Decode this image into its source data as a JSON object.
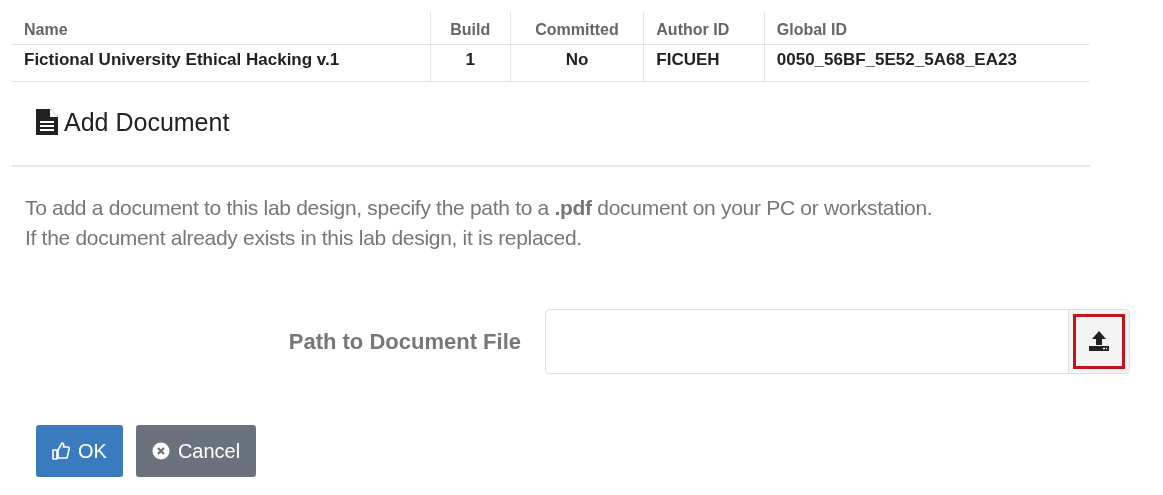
{
  "table": {
    "columns": [
      "Name",
      "Build",
      "Committed",
      "Author ID",
      "Global ID"
    ],
    "rows": [
      [
        "Fictional University Ethical Hacking v.1",
        "1",
        "No",
        "FICUEH",
        "0050_56BF_5E52_5A68_EA23"
      ]
    ]
  },
  "panel": {
    "title": "Add Document",
    "description": [
      "To add a document to this lab design, specify the path to a **.pdf** document on your PC or workstation.",
      "If the document already exists in this lab design, it is replaced."
    ],
    "field": {
      "label": "Path to Document File",
      "upload_highlighted": true
    }
  },
  "buttons": [
    {
      "label": "OK",
      "kind": "primary"
    },
    {
      "label": "Cancel",
      "kind": "secondary"
    }
  ]
}
